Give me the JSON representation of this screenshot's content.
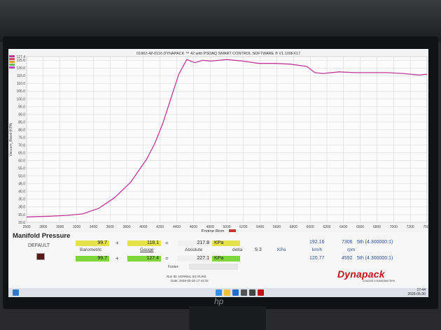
{
  "window_title": "01062-42-0116 DYNAPACK ™ 42 with PSDAQ SMART CONTROL SOFTWARE ® V1.100FX17",
  "monitor_brand": "hp",
  "chart_data": {
    "type": "line",
    "xlabel": "Engine Rpm",
    "ylabel": "Vacuum_Boost (KPA)",
    "x_ticks": [
      "2500",
      "2800",
      "3000",
      "3200",
      "3400",
      "3600",
      "3800",
      "4000",
      "4200",
      "4400",
      "4600",
      "4800",
      "5000",
      "5200",
      "5400",
      "5600",
      "5800",
      "6000",
      "6200",
      "6400",
      "6600",
      "6800",
      "7000",
      "7200",
      "7500"
    ],
    "y_ticks": [
      "127.4",
      "125.0",
      "120.0",
      "115.0",
      "110.0",
      "105.0",
      "100.0",
      "95.0",
      "90.0",
      "85.0",
      "80.0",
      "75.0",
      "70.0",
      "65.0",
      "60.0",
      "55.0",
      "50.0",
      "45.0",
      "40.0",
      "35.0",
      "30.0",
      "25.0",
      "20.0"
    ],
    "xlim": [
      2500,
      7500
    ],
    "ylim": [
      20,
      127.4
    ],
    "grid": true,
    "series": [
      {
        "color": "#c0399a",
        "x": [
          2500,
          2800,
          3000,
          3200,
          3400,
          3600,
          3800,
          4000,
          4100,
          4200,
          4300,
          4400,
          4500,
          4600,
          4700,
          4800,
          5000,
          5200,
          5400,
          5600,
          5800,
          6000,
          6100,
          6200,
          6400,
          6600,
          6800,
          7000,
          7200,
          7400,
          7500
        ],
        "y": [
          23.5,
          24,
          24.5,
          25.5,
          29,
          36,
          46,
          61,
          71,
          84,
          100,
          116,
          125.5,
          123.5,
          125,
          124.5,
          125.5,
          124.5,
          123,
          123,
          122.5,
          121,
          117,
          116.5,
          117.5,
          117,
          117,
          117,
          116.5,
          115.5,
          116
        ]
      }
    ],
    "legend_colors": [
      "#c0399a",
      "#e04070",
      "#e8a020",
      "#60c060",
      "#c040c0"
    ]
  },
  "panel": {
    "title": "Manifold Pressure",
    "mode": "DEFAULT",
    "row1": {
      "baro": "99.7",
      "plus": "+",
      "gauge": "118.1",
      "eq": "=",
      "abs": "217.8",
      "unit": "KPa"
    },
    "labels": {
      "baro": "Barometric",
      "gauge": "Gauge",
      "abs": "Absolute",
      "delta": "delta",
      "delta_val": "9.3",
      "delta_unit": "KPa"
    },
    "row2": {
      "baro": "99.7",
      "plus": "+",
      "gauge": "127.4",
      "eq": "=",
      "abs": "227.1",
      "unit": "KPa"
    },
    "speed1": "192.16",
    "speed_unit": "km/h",
    "speed2": "120.77",
    "rpm1": "7306",
    "rpm_unit": "rpm",
    "rpm2": "4592",
    "gear1": "5th (4.300000:1)",
    "gear2": "5th (4.300000:1)",
    "footer_label": "Footer:",
    "run_id": "Run ID: NORMAL 5G RUN3",
    "date": "Date: 2026-05-30 17:43:32"
  },
  "brand": {
    "name": "Dynapack",
    "sub": "CHASSIS DYNAMOMETERS"
  },
  "taskbar": {
    "time": "17:44",
    "date": "2026-05-30"
  }
}
